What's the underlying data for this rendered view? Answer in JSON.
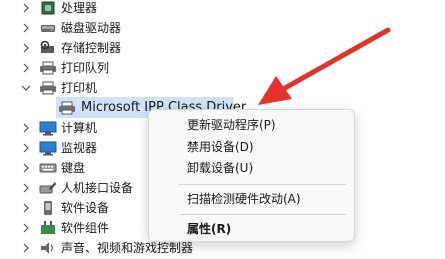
{
  "tree": {
    "items": [
      {
        "label": "处理器",
        "icon": "processor-icon"
      },
      {
        "label": "磁盘驱动器",
        "icon": "disk-drive-icon"
      },
      {
        "label": "存储控制器",
        "icon": "storage-controller-icon"
      },
      {
        "label": "打印队列",
        "icon": "print-queue-icon"
      },
      {
        "label": "打印机",
        "icon": "printer-icon",
        "expanded": true
      },
      {
        "label": "Microsoft IPP Class Driver",
        "icon": "printer-device-icon",
        "child": true
      },
      {
        "label": "计算机",
        "icon": "computer-icon"
      },
      {
        "label": "监视器",
        "icon": "monitor-icon"
      },
      {
        "label": "键盘",
        "icon": "keyboard-icon"
      },
      {
        "label": "人机接口设备",
        "icon": "hid-icon"
      },
      {
        "label": "软件设备",
        "icon": "software-device-icon"
      },
      {
        "label": "软件组件",
        "icon": "software-component-icon"
      },
      {
        "label": "声音、视频和游戏控制器",
        "icon": "sound-video-icon"
      }
    ]
  },
  "context_menu": {
    "update_driver": "更新驱动程序(P)",
    "disable_device": "禁用设备(D)",
    "uninstall_device": "卸载设备(U)",
    "scan_hardware": "扫描检测硬件改动(A)",
    "properties": "属性(R)"
  },
  "colors": {
    "selection": "#cfe2f8",
    "annotation_arrow": "#e8302a"
  }
}
